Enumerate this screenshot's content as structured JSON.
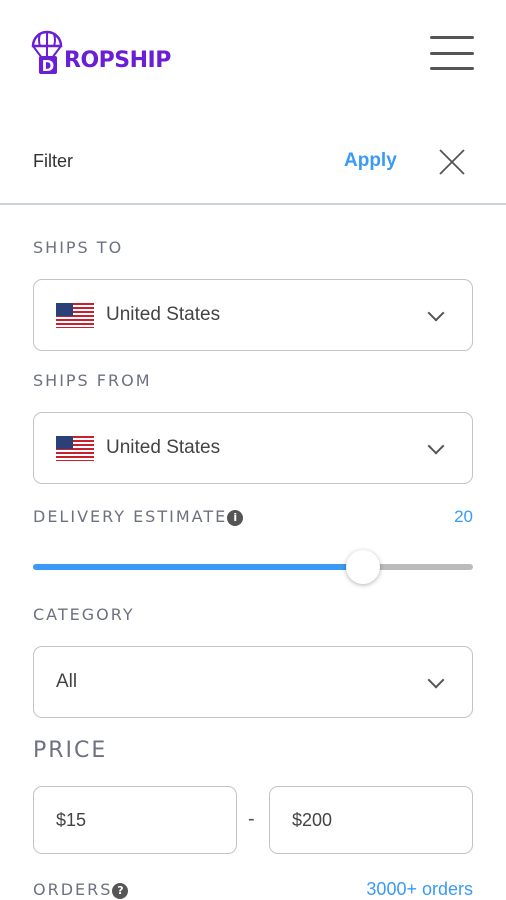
{
  "header": {
    "logo_text": "DROPSHIP",
    "brand_color": "#6a1fd6",
    "menu_icon": "hamburger-icon"
  },
  "filter": {
    "title": "Filter",
    "apply_label": "Apply",
    "close_icon": "close-icon"
  },
  "ships_to": {
    "label": "SHIPS TO",
    "value": "United States",
    "flag": "us-flag-icon"
  },
  "ships_from": {
    "label": "SHIPS FROM",
    "value": "United States",
    "flag": "us-flag-icon"
  },
  "delivery": {
    "label": "DELIVERY ESTIMATE",
    "info_icon": "i",
    "value": "20",
    "slider_fraction": 0.75
  },
  "category": {
    "label": "CATEGORY",
    "value": "All"
  },
  "price": {
    "label": "PRICE",
    "min": "$15",
    "separator": "-",
    "max": "$200"
  },
  "orders": {
    "label": "ORDERS",
    "help_icon": "?",
    "value": "3000+ orders"
  },
  "accent_color": "#3a9af5"
}
